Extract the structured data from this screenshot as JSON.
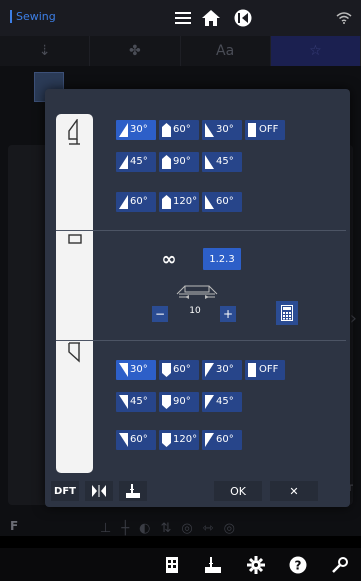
{
  "header": {
    "app_title": "Sewing",
    "icons": [
      "menu-icon",
      "home-icon",
      "back-circle-icon",
      "wifi-icon"
    ]
  },
  "tabs": [
    {
      "icon": "stitch-tab-icon"
    },
    {
      "icon": "pattern-tab-icon"
    },
    {
      "label": "Aa"
    },
    {
      "icon": "favorite-tab-icon"
    }
  ],
  "background": {
    "dft_label": "DFT",
    "f_label": "F"
  },
  "dialog": {
    "start_section": {
      "icon": "stitch-start-icon",
      "options": [
        {
          "label": "30°",
          "icon": "taper-left-icon"
        },
        {
          "label": "60°",
          "icon": "taper-center-icon"
        },
        {
          "label": "30°",
          "icon": "taper-right-icon"
        },
        {
          "label": "OFF",
          "icon": "square-icon"
        },
        {
          "label": "45°",
          "icon": "taper-left-icon"
        },
        {
          "label": "90°",
          "icon": "taper-center-icon"
        },
        {
          "label": "45°",
          "icon": "taper-right-icon"
        },
        {
          "label": "60°",
          "icon": "taper-left-icon"
        },
        {
          "label": "120°",
          "icon": "taper-center-icon"
        },
        {
          "label": "60°",
          "icon": "taper-right-icon"
        }
      ]
    },
    "middle_section": {
      "icon": "stitch-middle-icon",
      "loop_label": "∞",
      "sequence_label": "1.2.3",
      "length_value": "10",
      "minus_label": "−",
      "plus_label": "+"
    },
    "end_section": {
      "icon": "stitch-end-icon",
      "options": [
        {
          "label": "30°",
          "icon": "taper-left-icon"
        },
        {
          "label": "60°",
          "icon": "taper-center-icon"
        },
        {
          "label": "30°",
          "icon": "taper-right-icon"
        },
        {
          "label": "OFF",
          "icon": "square-icon"
        },
        {
          "label": "45°",
          "icon": "taper-left-icon"
        },
        {
          "label": "90°",
          "icon": "taper-center-icon"
        },
        {
          "label": "45°",
          "icon": "taper-right-icon"
        },
        {
          "label": "60°",
          "icon": "taper-left-icon"
        },
        {
          "label": "120°",
          "icon": "taper-center-icon"
        },
        {
          "label": "60°",
          "icon": "taper-right-icon"
        }
      ]
    },
    "footer": {
      "dft_label": "DFT",
      "ok_label": "OK",
      "close_label": "✕"
    }
  },
  "bottom_bar": {
    "icons": [
      "tutorial-icon",
      "needle-down-icon",
      "settings-icon",
      "help-icon",
      "tools-icon"
    ]
  },
  "colors": {
    "option_bg": "#27458a",
    "selected_bg": "#2d5fc8",
    "dialog_bg": "#2d3443",
    "accent": "#3d7fe6"
  }
}
